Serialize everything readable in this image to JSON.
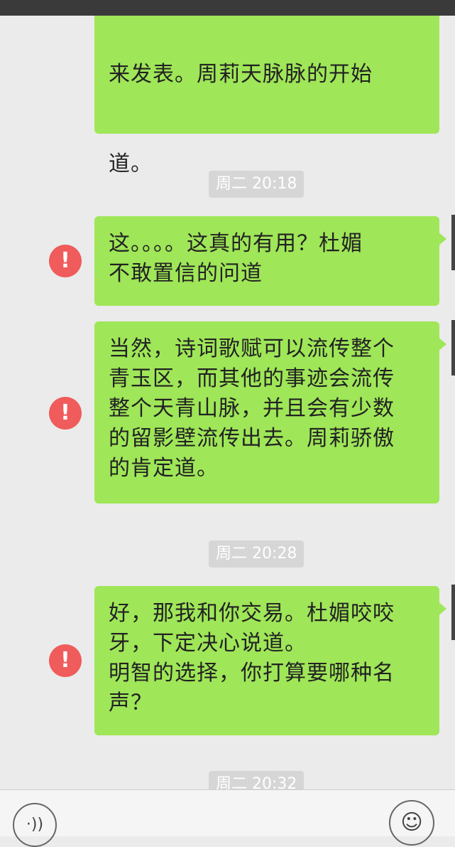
{
  "messages": [
    {
      "text": "道。",
      "partial_top_text": "来发表。周莉天脉脉的开始",
      "status_icon": "none"
    },
    {
      "text": "这。。。。这真的有用？杜媚\n不敢置信的问道",
      "status_icon": "error-icon"
    },
    {
      "text": "当然，诗词歌赋可以流传整个\n青玉区，而其他的事迹会流传\n整个天青山脉，并且会有少数\n的留影壁流传出去。周莉骄傲\n的肯定道。",
      "status_icon": "error-icon"
    },
    {
      "text": "好，那我和你交易。杜媚咬咬\n牙，下定决心说道。\n明智的选择，你打算要哪种名\n声？",
      "status_icon": "error-icon"
    }
  ],
  "timestamps": {
    "t1": "周二 20:18",
    "t2": "周二 20:28",
    "t3": "周二 20:32"
  },
  "error_glyph": "!",
  "bottom_bar": {
    "voice_icon": "voice-icon",
    "voice_glyph": "·))",
    "emoji_icon": "emoji-icon",
    "emoji_glyph": "☺"
  },
  "colors": {
    "bubble": "#9fe658",
    "error": "#f05b5b",
    "background": "#ebebeb",
    "timestamp_bg": "#d6d6d6"
  }
}
